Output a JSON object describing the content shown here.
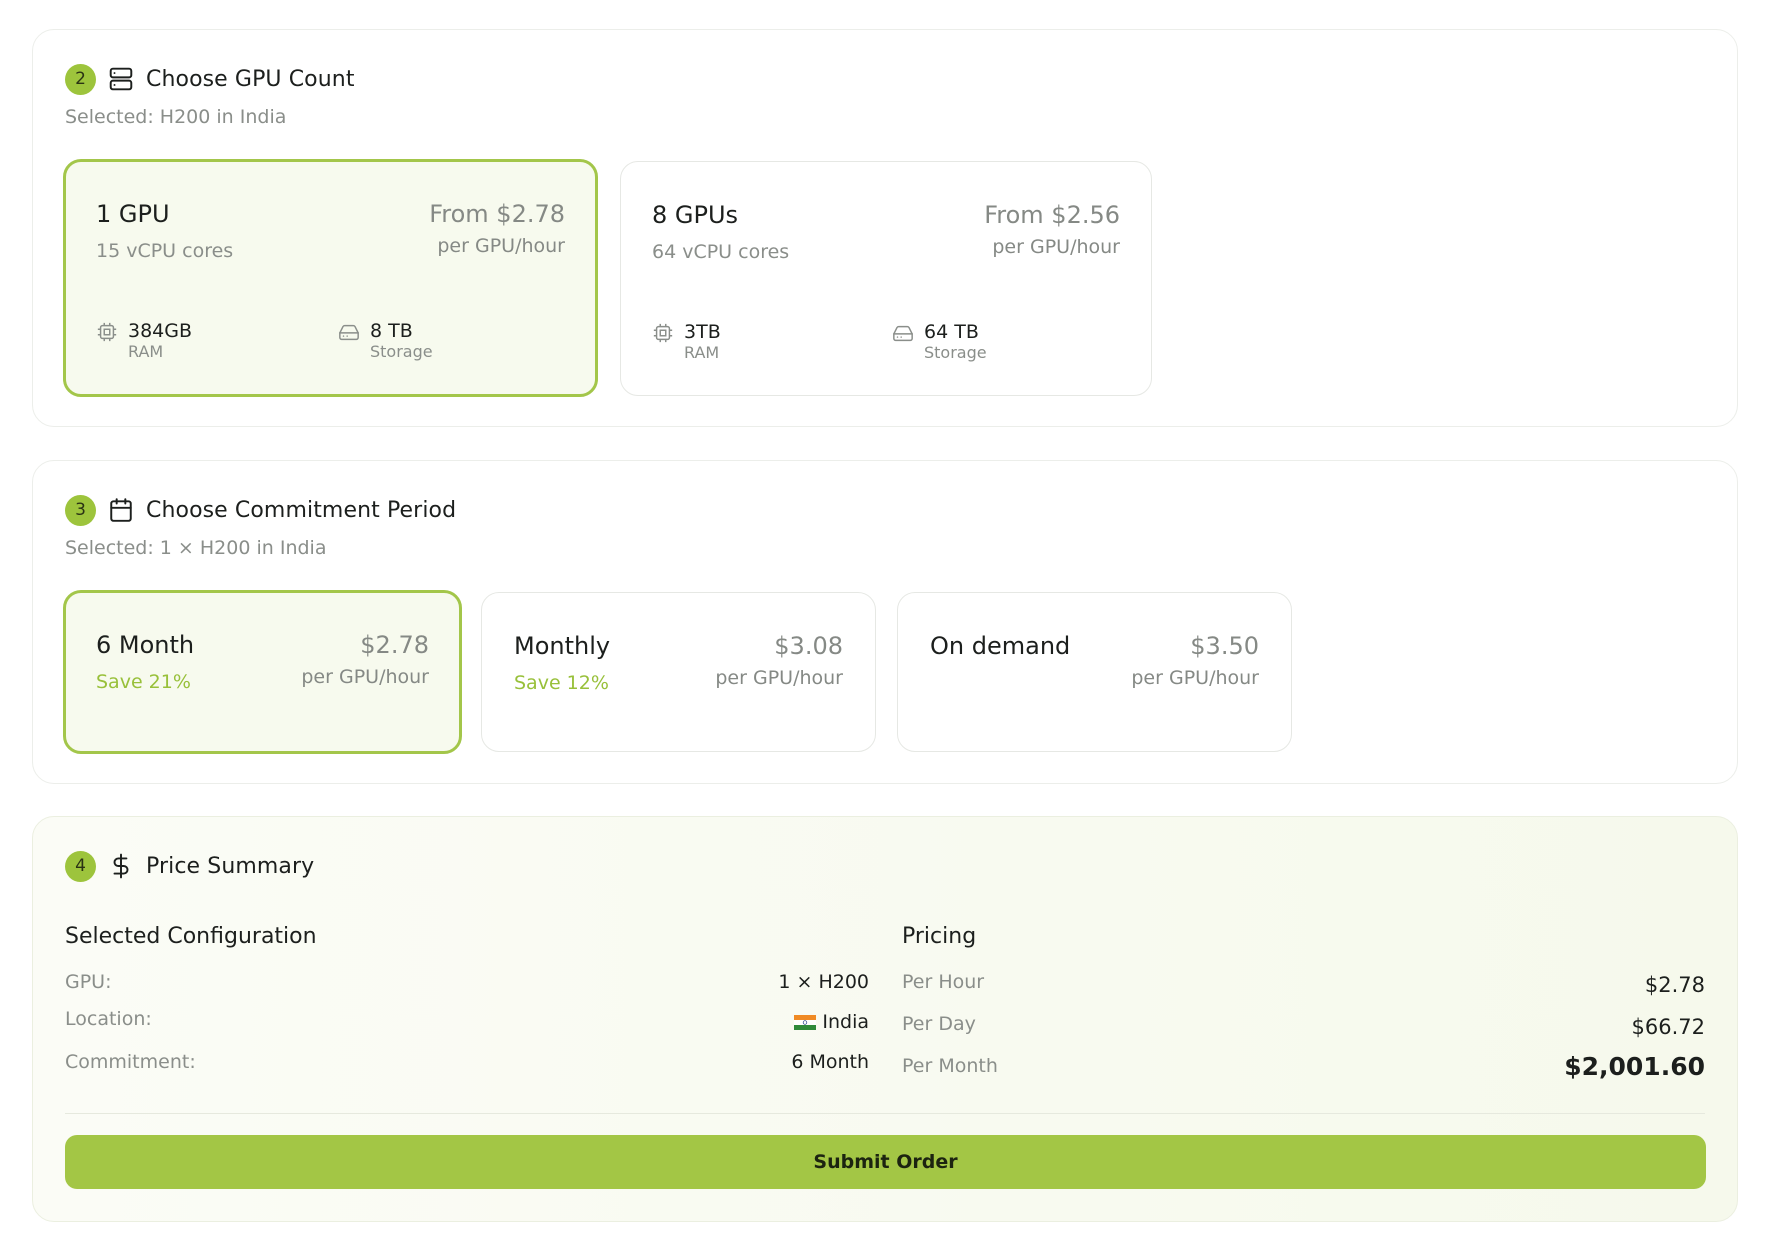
{
  "gpu_count": {
    "step": "2",
    "icon": "server-icon",
    "title": "Choose GPU Count",
    "selected_text": "Selected: H200 in India",
    "options": [
      {
        "title": "1 GPU",
        "cores": "15 vCPU cores",
        "price": "From $2.78",
        "unit": "per GPU/hour",
        "ram_value": "384GB",
        "ram_label": "RAM",
        "storage_value": "8 TB",
        "storage_label": "Storage",
        "selected": true
      },
      {
        "title": "8 GPUs",
        "cores": "64 vCPU cores",
        "price": "From $2.56",
        "unit": "per GPU/hour",
        "ram_value": "3TB",
        "ram_label": "RAM",
        "storage_value": "64 TB",
        "storage_label": "Storage",
        "selected": false
      }
    ]
  },
  "commitment": {
    "step": "3",
    "icon": "calendar-icon",
    "title": "Choose Commitment Period",
    "selected_text": "Selected: 1 × H200 in India",
    "options": [
      {
        "title": "6 Month",
        "save": "Save 21%",
        "price": "$2.78",
        "unit": "per GPU/hour",
        "selected": true
      },
      {
        "title": "Monthly",
        "save": "Save 12%",
        "price": "$3.08",
        "unit": "per GPU/hour",
        "selected": false
      },
      {
        "title": "On demand",
        "save": "",
        "price": "$3.50",
        "unit": "per GPU/hour",
        "selected": false
      }
    ]
  },
  "summary": {
    "step": "4",
    "icon": "dollar-icon",
    "title": "Price Summary",
    "config_title": "Selected Configuration",
    "config": [
      {
        "label": "GPU:",
        "value": "1 × H200"
      },
      {
        "label": "Location:",
        "value": "India",
        "flag": "india-flag-icon"
      },
      {
        "label": "Commitment:",
        "value": "6 Month"
      }
    ],
    "pricing_title": "Pricing",
    "pricing": [
      {
        "label": "Per Hour",
        "value": "$2.78"
      },
      {
        "label": "Per Day",
        "value": "$66.72"
      },
      {
        "label": "Per Month",
        "value": "$2,001.60"
      }
    ],
    "submit_label": "Submit Order"
  },
  "colors": {
    "accent": "#a3c645",
    "accent_text": "#98c03a",
    "selected_bg": "#f7faee",
    "muted_text": "#8a8e8a"
  }
}
